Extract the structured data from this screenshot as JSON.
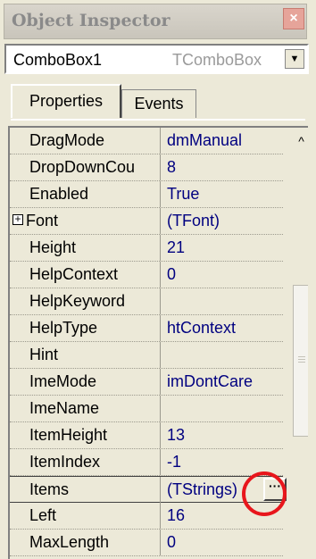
{
  "window": {
    "title": "Object Inspector",
    "close_glyph": "×"
  },
  "combo": {
    "name": "ComboBox1",
    "type": "TComboBox",
    "arrow_glyph": "▼"
  },
  "tabs": [
    {
      "label": "Properties"
    },
    {
      "label": "Events"
    }
  ],
  "properties": [
    {
      "name": "DragMode",
      "value": "dmManual"
    },
    {
      "name": "DropDownCou",
      "value": "8"
    },
    {
      "name": "Enabled",
      "value": "True"
    },
    {
      "name": "Font",
      "value": "(TFont)",
      "expand_glyph": "+"
    },
    {
      "name": "Height",
      "value": "21"
    },
    {
      "name": "HelpContext",
      "value": "0"
    },
    {
      "name": "HelpKeyword",
      "value": ""
    },
    {
      "name": "HelpType",
      "value": "htContext"
    },
    {
      "name": "Hint",
      "value": ""
    },
    {
      "name": "ImeMode",
      "value": "imDontCare"
    },
    {
      "name": "ImeName",
      "value": ""
    },
    {
      "name": "ItemHeight",
      "value": "13"
    },
    {
      "name": "ItemIndex",
      "value": "-1"
    },
    {
      "name": "Items",
      "value": "(TStrings)",
      "selected": true,
      "ellipsis": "···"
    },
    {
      "name": "Left",
      "value": "16"
    },
    {
      "name": "MaxLength",
      "value": "0"
    }
  ],
  "scrollbar": {
    "up_glyph": "^"
  },
  "colors": {
    "value_text": "#000080",
    "annotation": "#e8161c",
    "background": "#ece9d8"
  }
}
